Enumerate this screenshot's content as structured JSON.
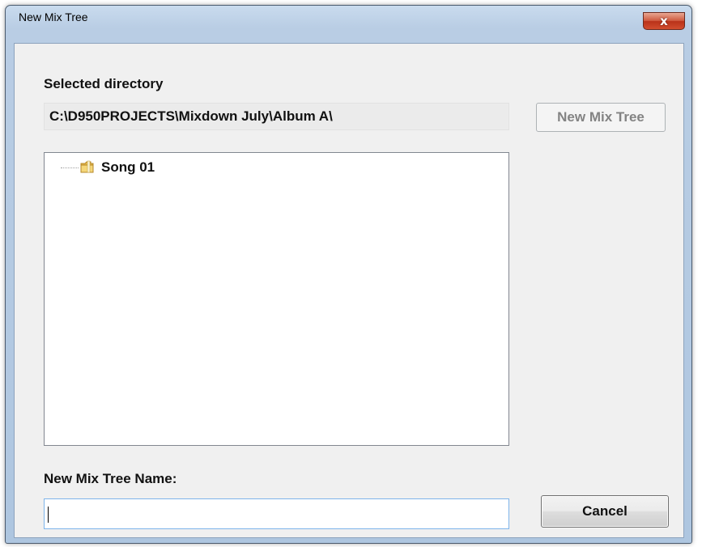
{
  "window": {
    "title": "New Mix Tree",
    "close_glyph": "x"
  },
  "selected_directory": {
    "label": "Selected directory",
    "path": "C:\\D950PROJECTS\\Mixdown July\\Album A\\"
  },
  "buttons": {
    "new_mix_tree": "New Mix Tree",
    "new_mix_tree_enabled": false,
    "cancel": "Cancel"
  },
  "tree": {
    "items": [
      {
        "label": "Song 01",
        "icon": "folder-icon"
      }
    ]
  },
  "name_field": {
    "label": "New Mix Tree Name:",
    "value": "",
    "placeholder": ""
  },
  "colors": {
    "titlebar": "#b9cde4",
    "close_button": "#c7462b",
    "input_focus_border": "#7eb4ea"
  }
}
